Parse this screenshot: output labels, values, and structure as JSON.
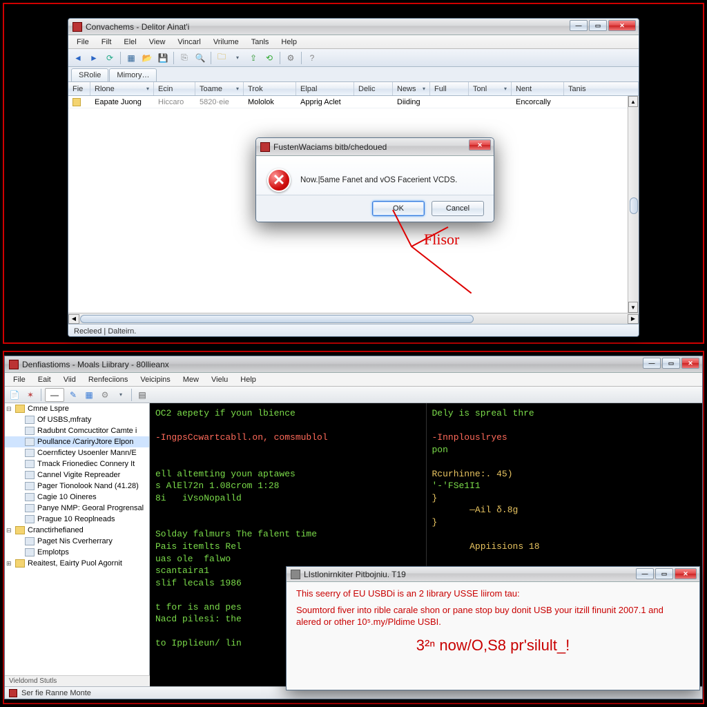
{
  "panel1": {
    "window": {
      "title": "Convachems - Delitor Ainat'i",
      "menu": [
        "File",
        "Filt",
        "Elel",
        "View",
        "Vincarl",
        "Vrilume",
        "Tanls",
        "Help"
      ],
      "tabs": [
        "SRolie",
        "Mimory…"
      ],
      "columns": [
        "Fie",
        "Rlone",
        "Ecin",
        "Toame",
        "Trok",
        "Elpal",
        "Delic",
        "News",
        "Full",
        "Tonl",
        "Nent",
        "Tanis"
      ],
      "row": [
        "",
        "Eapate Juong",
        "Hiccaro",
        "5820·eie",
        "Mololok",
        "Apprig Aclet",
        "",
        "Diiding",
        "",
        "",
        "Encorcally",
        ""
      ],
      "status": "Recleed | Dalteirn."
    },
    "dialog": {
      "title": "FustenWaciams bitb/chedoued",
      "message": "Now.|5ame Fanet and vOS Facerient VCDS.",
      "ok": "OK",
      "cancel": "Cancel"
    },
    "annotation": "Flisor"
  },
  "panel2": {
    "window": {
      "title": "Denfiastioms - Moals Liibrary - 80llieanx",
      "menu": [
        "File",
        "Eait",
        "Viid",
        "Renfeciions",
        "Veicipins",
        "Mew",
        "Vielu",
        "Help"
      ],
      "tree": [
        {
          "lvl": 0,
          "type": "folder",
          "fold": "-",
          "label": "Cmne Lspre"
        },
        {
          "lvl": 1,
          "type": "page",
          "label": "Of USBS,mfraty"
        },
        {
          "lvl": 1,
          "type": "page",
          "label": "Radubnt Comcuctitor Camte i"
        },
        {
          "lvl": 1,
          "type": "page",
          "sel": true,
          "label": "Poullance /CariryJtore Elpon"
        },
        {
          "lvl": 1,
          "type": "page",
          "label": "Coernfictey Usoenler Mann/E"
        },
        {
          "lvl": 1,
          "type": "page",
          "label": "Tmack Frionediec Connery It"
        },
        {
          "lvl": 1,
          "type": "page",
          "label": "Cannel Vigite Repreader"
        },
        {
          "lvl": 1,
          "type": "page",
          "label": "Pager Tionolook Nand (41.28)"
        },
        {
          "lvl": 1,
          "type": "page",
          "label": "Cagie 10 Oineres"
        },
        {
          "lvl": 1,
          "type": "page",
          "label": "Panye NMP: Georal Progrensal"
        },
        {
          "lvl": 1,
          "type": "page",
          "label": "Prague 10 Reoplneads"
        },
        {
          "lvl": 0,
          "type": "folder",
          "fold": "-",
          "label": "Cranctirhefianed"
        },
        {
          "lvl": 1,
          "type": "page",
          "label": "Paget Nis Cverherrary"
        },
        {
          "lvl": 1,
          "type": "page",
          "label": "Emplotps"
        },
        {
          "lvl": 0,
          "type": "folder",
          "fold": "+",
          "label": "Reaitest, Eairty Puol Agornit"
        }
      ],
      "term_left": "OC2 aepety if youn lbience\n\n-IngpsCcwartcabll.on, comsmublol\n\n\nell altemting youn aptawes\ns AlEl72n 1.08crom 1:28\n8i   iVsoNopalld\n\n\nSolday falmurs The falent time\nPais itemlts Rel\nuas ole  falwo\nscantaira1\nslif lecals 1986\n\nt for is and pes\nNacd pilesi: the\n\nto Ipplieun/ lin",
      "term_right": "Dely is spreal thre\n\n-Innplouslryes\npon\n\nRcurhinne:. 45)\n'-'FSe1I1\n}\n       —Ail δ.8g\n}\n\n       Appiisions 18",
      "status_left": "Vieldomd Stutls",
      "status_bottom": "Ser fie Ranne Monte"
    },
    "info": {
      "title": "LIstlonirnkiter Pitbojniu. T19",
      "line1": "This seerry of EU USBDi is an 2 Iibrary USSE liirom tau:",
      "line2": "Soumtord fiver into rible carale shon or pane stop buy donit USB your itzill finunit 2007.1 and alered or other 10⁵.my/Pldime USBI.",
      "big": "3²ⁿ  now/O,S8 pr'silult_!"
    }
  }
}
